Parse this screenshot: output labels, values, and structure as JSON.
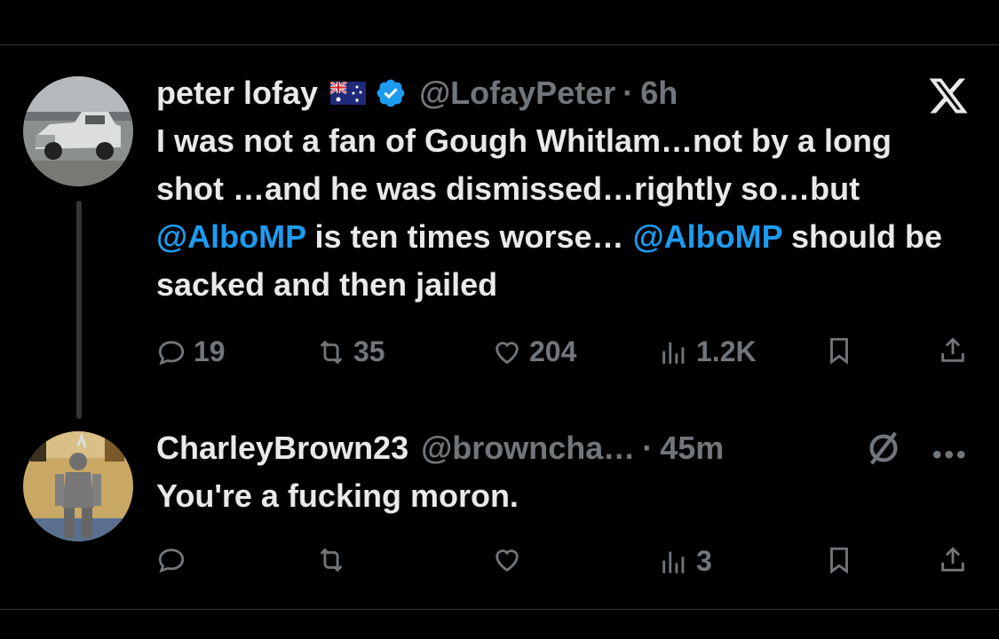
{
  "tweets": [
    {
      "display_name": "peter lofay",
      "flag_icon": "australia-flag-icon",
      "verified_icon": "verified-badge-icon",
      "handle": "@LofayPeter",
      "separator": "·",
      "time": "6h",
      "text_segments": [
        "I was not a fan of Gough Whitlam…not by a long shot …and he was dismissed…rightly so…but ",
        "@AlboMP",
        " is ten times worse… ",
        "@AlboMP",
        " should be sacked and then jailed"
      ],
      "stats": {
        "replies": "19",
        "reposts": "35",
        "likes": "204",
        "views": "1.2K"
      }
    },
    {
      "display_name": "CharleyBrown23",
      "handle": "@browncha…",
      "separator": "·",
      "time": "45m",
      "text": "You're a fucking moron.",
      "stats": {
        "replies": "",
        "reposts": "",
        "likes": "",
        "views": "3"
      }
    }
  ],
  "colors": {
    "background": "#000000",
    "text": "#e7e9ea",
    "muted": "#71767b",
    "accent": "#1d9bf0",
    "divider": "#2f3336"
  },
  "icons": [
    "x-logo-icon",
    "reply-icon",
    "repost-icon",
    "like-icon",
    "views-icon",
    "bookmark-icon",
    "share-icon",
    "grok-icon",
    "more-icon"
  ]
}
